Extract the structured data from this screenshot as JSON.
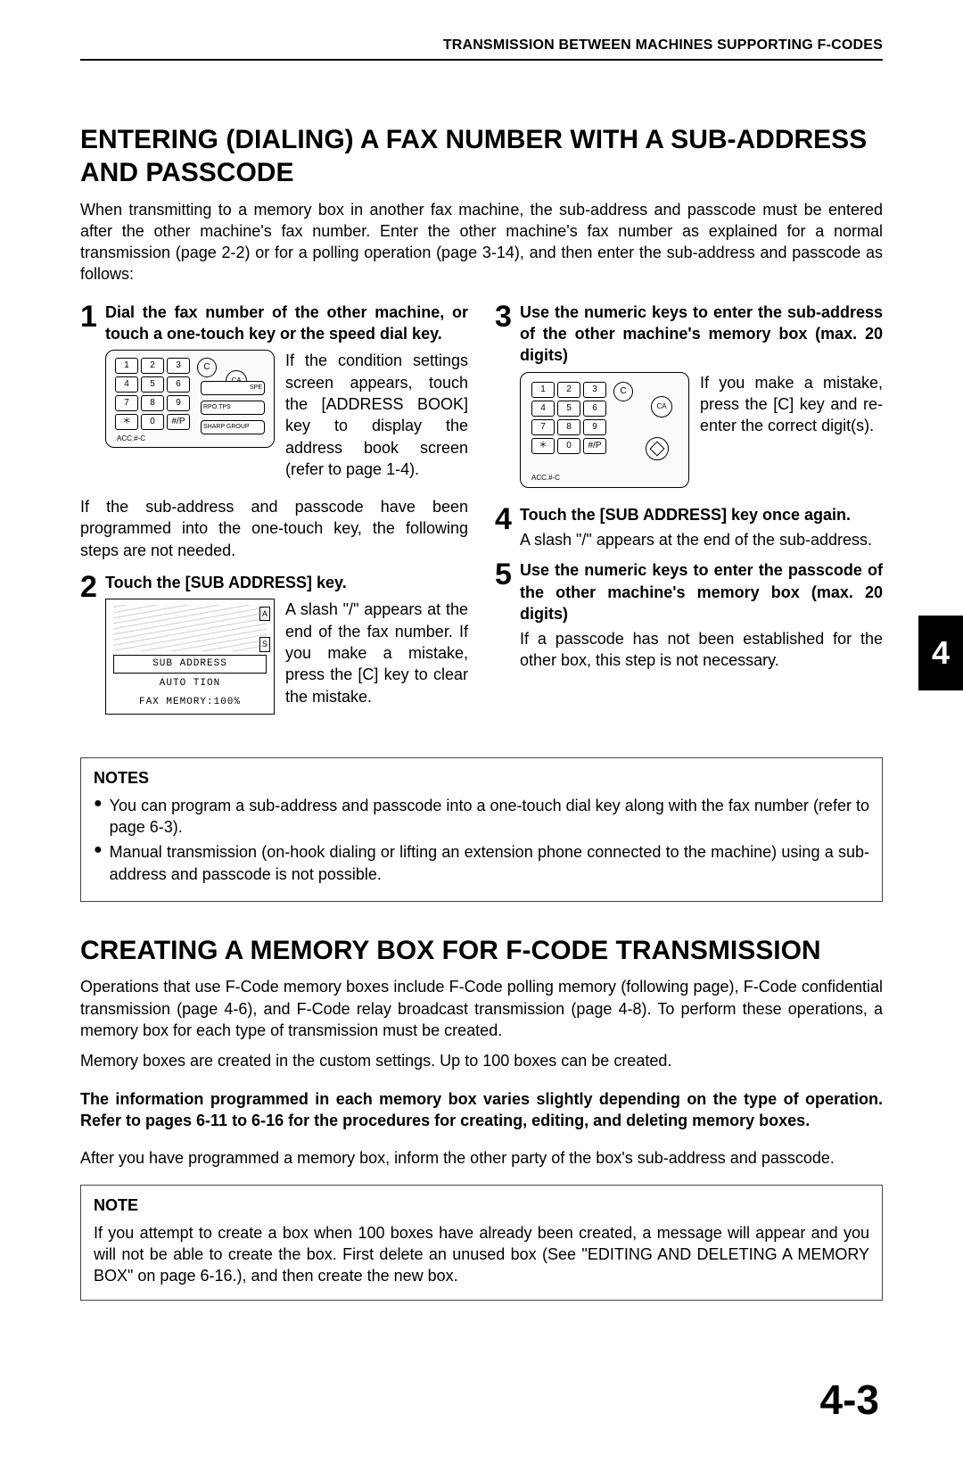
{
  "running_head": "TRANSMISSION BETWEEN MACHINES SUPPORTING F-CODES",
  "chapter_tab": "4",
  "page_number": "4-3",
  "section1": {
    "title": "ENTERING (DIALING) A FAX NUMBER WITH A SUB-ADDRESS AND PASSCODE",
    "intro": "When transmitting to a memory box in another fax machine, the sub-address and passcode must be entered after the other machine's fax number. Enter the other machine's fax number as explained for a normal transmission (page 2-2) or for a polling operation (page 3-14), and then enter the sub-address and passcode as follows:"
  },
  "steps": {
    "s1": {
      "num": "1",
      "title": "Dial the fax number of the other machine, or touch a one-touch key or the speed dial key.",
      "side": "If the condition settings screen appears, touch the [ADDRESS BOOK] key to display the address book screen (refer to page 1-4).",
      "cont": "If the sub-address and passcode have been programmed into the one-touch key, the following steps are not needed."
    },
    "s2": {
      "num": "2",
      "title": "Touch the [SUB ADDRESS] key.",
      "side": "A slash \"/\" appears at the end of the fax number. If you make a mistake, press the [C] key to clear the mistake."
    },
    "s3": {
      "num": "3",
      "title": "Use the numeric keys to enter the sub-address of the other machine's memory box (max. 20 digits)",
      "side": "If you make a mistake, press the [C] key and re-enter the correct digit(s)."
    },
    "s4": {
      "num": "4",
      "title": "Touch the [SUB ADDRESS] key once again.",
      "text": "A slash \"/\" appears at the end of the sub-address."
    },
    "s5": {
      "num": "5",
      "title": "Use the numeric keys to enter the passcode of the other machine's memory box (max. 20 digits)",
      "text": "If a passcode has not been established for the other box, this step is not necessary."
    }
  },
  "illus": {
    "keys": [
      "1",
      "2",
      "3",
      "4",
      "5",
      "6",
      "7",
      "8",
      "9",
      "＊",
      "0",
      "#/P"
    ],
    "c_key": "C",
    "acc": "ACC.#-C",
    "ca": "CA",
    "spkr": "SPE",
    "bar2t": "RPO.TPS",
    "bar3t": "SHARP GROUP",
    "panel2_sub": "SUB ADDRESS",
    "panel2_auto": "AUTO        TION",
    "panel2_mem": "FAX MEMORY:100%",
    "panel2_side_a": "A",
    "panel2_side_s": "S"
  },
  "notes": {
    "hdr": "NOTES",
    "n1": "You can program a sub-address and passcode into a one-touch dial key along with the fax number (refer to page 6-3).",
    "n2": "Manual transmission (on-hook dialing or lifting an extension phone connected to the machine) using a sub-address and passcode is not possible."
  },
  "section2": {
    "title": "CREATING A MEMORY BOX FOR F-CODE TRANSMISSION",
    "p1": "Operations that use F-Code memory boxes include F-Code polling memory (following page), F-Code confidential transmission (page 4-6), and F-Code relay broadcast transmission (page 4-8). To perform these operations, a memory box for each type of transmission must be created.",
    "p2": "Memory boxes are created in the custom settings. Up to 100 boxes can be created.",
    "bold": "The information programmed in each memory box varies slightly depending on the type of operation. Refer to pages 6-11 to 6-16 for the procedures for creating, editing, and deleting memory boxes.",
    "after": "After you have programmed a memory box, inform the other party of the box's sub-address and passcode."
  },
  "note2": {
    "hdr": "NOTE",
    "text": "If you attempt to create a box when 100 boxes have already been created, a message will appear and you will not be able to create the box. First delete an unused box (See \"EDITING AND DELETING A MEMORY BOX\" on page 6-16.), and then create the new box."
  }
}
